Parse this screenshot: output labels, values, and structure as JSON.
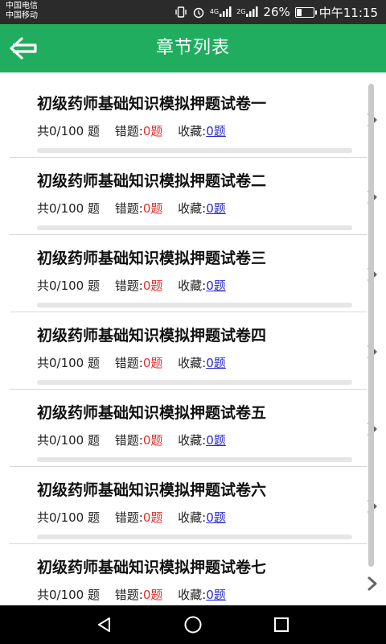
{
  "status_bar": {
    "carrier_1": "中国电信",
    "carrier_2": "中国移动",
    "network_4g": "4G",
    "network_2g": "2G",
    "battery_percent": "26%",
    "time": "中午11:15"
  },
  "app_bar": {
    "title": "章节列表",
    "back_icon": "arrow-left-icon",
    "color": "#20ad5f"
  },
  "chapters": [
    {
      "title": "初级药师基础知识模拟押题试卷一",
      "total": "共0/100 题",
      "wrong_label": "错题:",
      "wrong_value": "0题",
      "fav_label": "收藏:",
      "fav_value": "0题",
      "progress": 0
    },
    {
      "title": "初级药师基础知识模拟押题试卷二",
      "total": "共0/100 题",
      "wrong_label": "错题:",
      "wrong_value": "0题",
      "fav_label": "收藏:",
      "fav_value": "0题",
      "progress": 0
    },
    {
      "title": "初级药师基础知识模拟押题试卷三",
      "total": "共0/100 题",
      "wrong_label": "错题:",
      "wrong_value": "0题",
      "fav_label": "收藏:",
      "fav_value": "0题",
      "progress": 0
    },
    {
      "title": "初级药师基础知识模拟押题试卷四",
      "total": "共0/100 题",
      "wrong_label": "错题:",
      "wrong_value": "0题",
      "fav_label": "收藏:",
      "fav_value": "0题",
      "progress": 0
    },
    {
      "title": "初级药师基础知识模拟押题试卷五",
      "total": "共0/100 题",
      "wrong_label": "错题:",
      "wrong_value": "0题",
      "fav_label": "收藏:",
      "fav_value": "0题",
      "progress": 0
    },
    {
      "title": "初级药师基础知识模拟押题试卷六",
      "total": "共0/100 题",
      "wrong_label": "错题:",
      "wrong_value": "0题",
      "fav_label": "收藏:",
      "fav_value": "0题",
      "progress": 0
    },
    {
      "title": "初级药师基础知识模拟押题试卷七",
      "total": "共0/100 题",
      "wrong_label": "错题:",
      "wrong_value": "0题",
      "fav_label": "收藏:",
      "fav_value": "0题",
      "progress": 0
    }
  ],
  "colors": {
    "wrong": "#e03030",
    "favorite": "#2a2ad0"
  },
  "nav_bar": {
    "back": "triangle-back-icon",
    "home": "circle-home-icon",
    "recents": "square-recents-icon"
  }
}
